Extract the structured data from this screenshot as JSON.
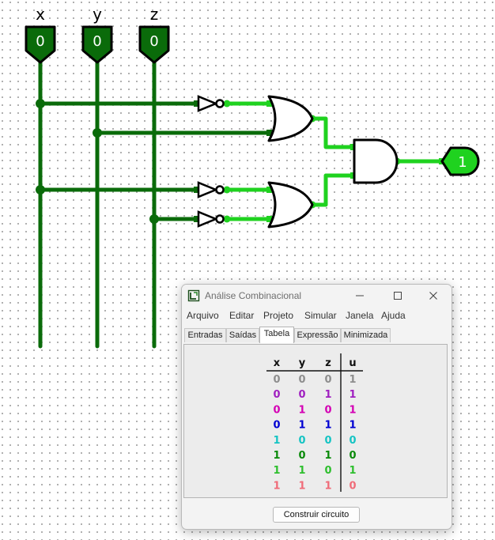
{
  "circuit": {
    "inputs": [
      {
        "label": "x",
        "value": "0"
      },
      {
        "label": "y",
        "value": "0"
      },
      {
        "label": "z",
        "value": "0"
      }
    ],
    "output": {
      "value": "1"
    },
    "colors": {
      "wire_low": "#0a6b0a",
      "wire_high": "#1fd21f",
      "pin_fill": "#0a6b0a",
      "output_fill": "#1fd21f"
    }
  },
  "window": {
    "title": "Análise Combinacional",
    "menu": [
      "Arquivo",
      "Editar",
      "Projeto",
      "Simular",
      "Janela",
      "Ajuda"
    ],
    "tabs": [
      "Entradas",
      "Saídas",
      "Tabela",
      "Expressão",
      "Minimizada"
    ],
    "active_tab": "Tabela",
    "build_button": "Construir circuito"
  },
  "truth_table": {
    "headers": [
      "x",
      "y",
      "z",
      "u"
    ],
    "rows": [
      [
        "0",
        "0",
        "0",
        "1"
      ],
      [
        "0",
        "0",
        "1",
        "1"
      ],
      [
        "0",
        "1",
        "0",
        "1"
      ],
      [
        "0",
        "1",
        "1",
        "1"
      ],
      [
        "1",
        "0",
        "0",
        "0"
      ],
      [
        "1",
        "0",
        "1",
        "0"
      ],
      [
        "1",
        "1",
        "0",
        "1"
      ],
      [
        "1",
        "1",
        "1",
        "0"
      ]
    ],
    "row_colors": [
      "#8e8e8e",
      "#a020c0",
      "#d400b4",
      "#0000d2",
      "#16c4c4",
      "#0a8a0a",
      "#2fbf2f",
      "#f06b78"
    ]
  }
}
